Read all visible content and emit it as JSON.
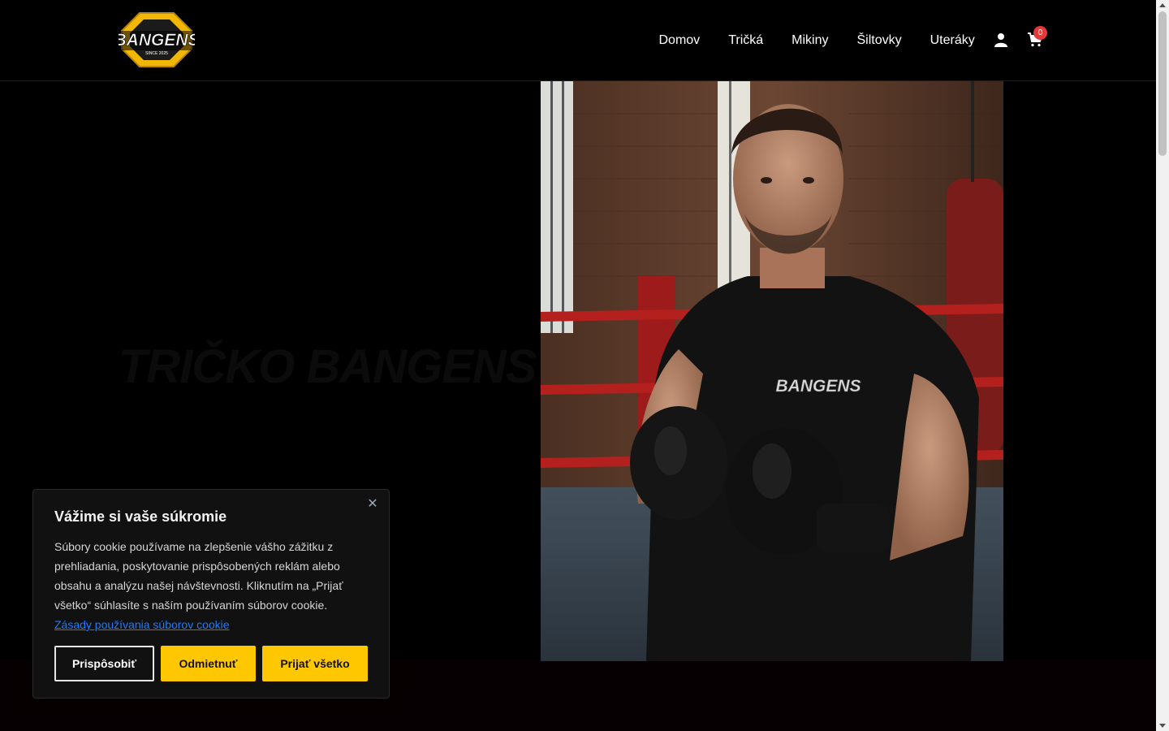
{
  "brand": {
    "logo_text": "BANGENS",
    "logo_tagline": "SINCE 2025",
    "accent_color": "#f2b705"
  },
  "nav": {
    "items": [
      {
        "label": "Domov"
      },
      {
        "label": "Tričká"
      },
      {
        "label": "Mikiny"
      },
      {
        "label": "Šiltovky"
      },
      {
        "label": "Uteráky"
      }
    ],
    "user_icon": "user-icon",
    "cart_icon": "cart-icon",
    "cart_count": "0"
  },
  "hero": {
    "title": "TRIČKO BANGENS",
    "shirt_print": "BANGENS"
  },
  "cookie_banner": {
    "title": "Vážime si vaše súkromie",
    "text": "Súbory cookie používame na zlepšenie vášho zážitku z prehliadania, poskytovanie prispôsobených reklám alebo obsahu a analýzu našej návštevnosti. Kliknutím na „Prijať všetko“ súhlasíte s naším používaním súborov cookie.",
    "link_text": "Zásady používania súborov cookie",
    "buttons": {
      "customize": "Prispôsobiť",
      "reject": "Odmietnuť",
      "accept": "Prijať všetko"
    },
    "close_icon": "close-icon",
    "button_color": "#ffc700",
    "link_color": "#1e7bff"
  }
}
